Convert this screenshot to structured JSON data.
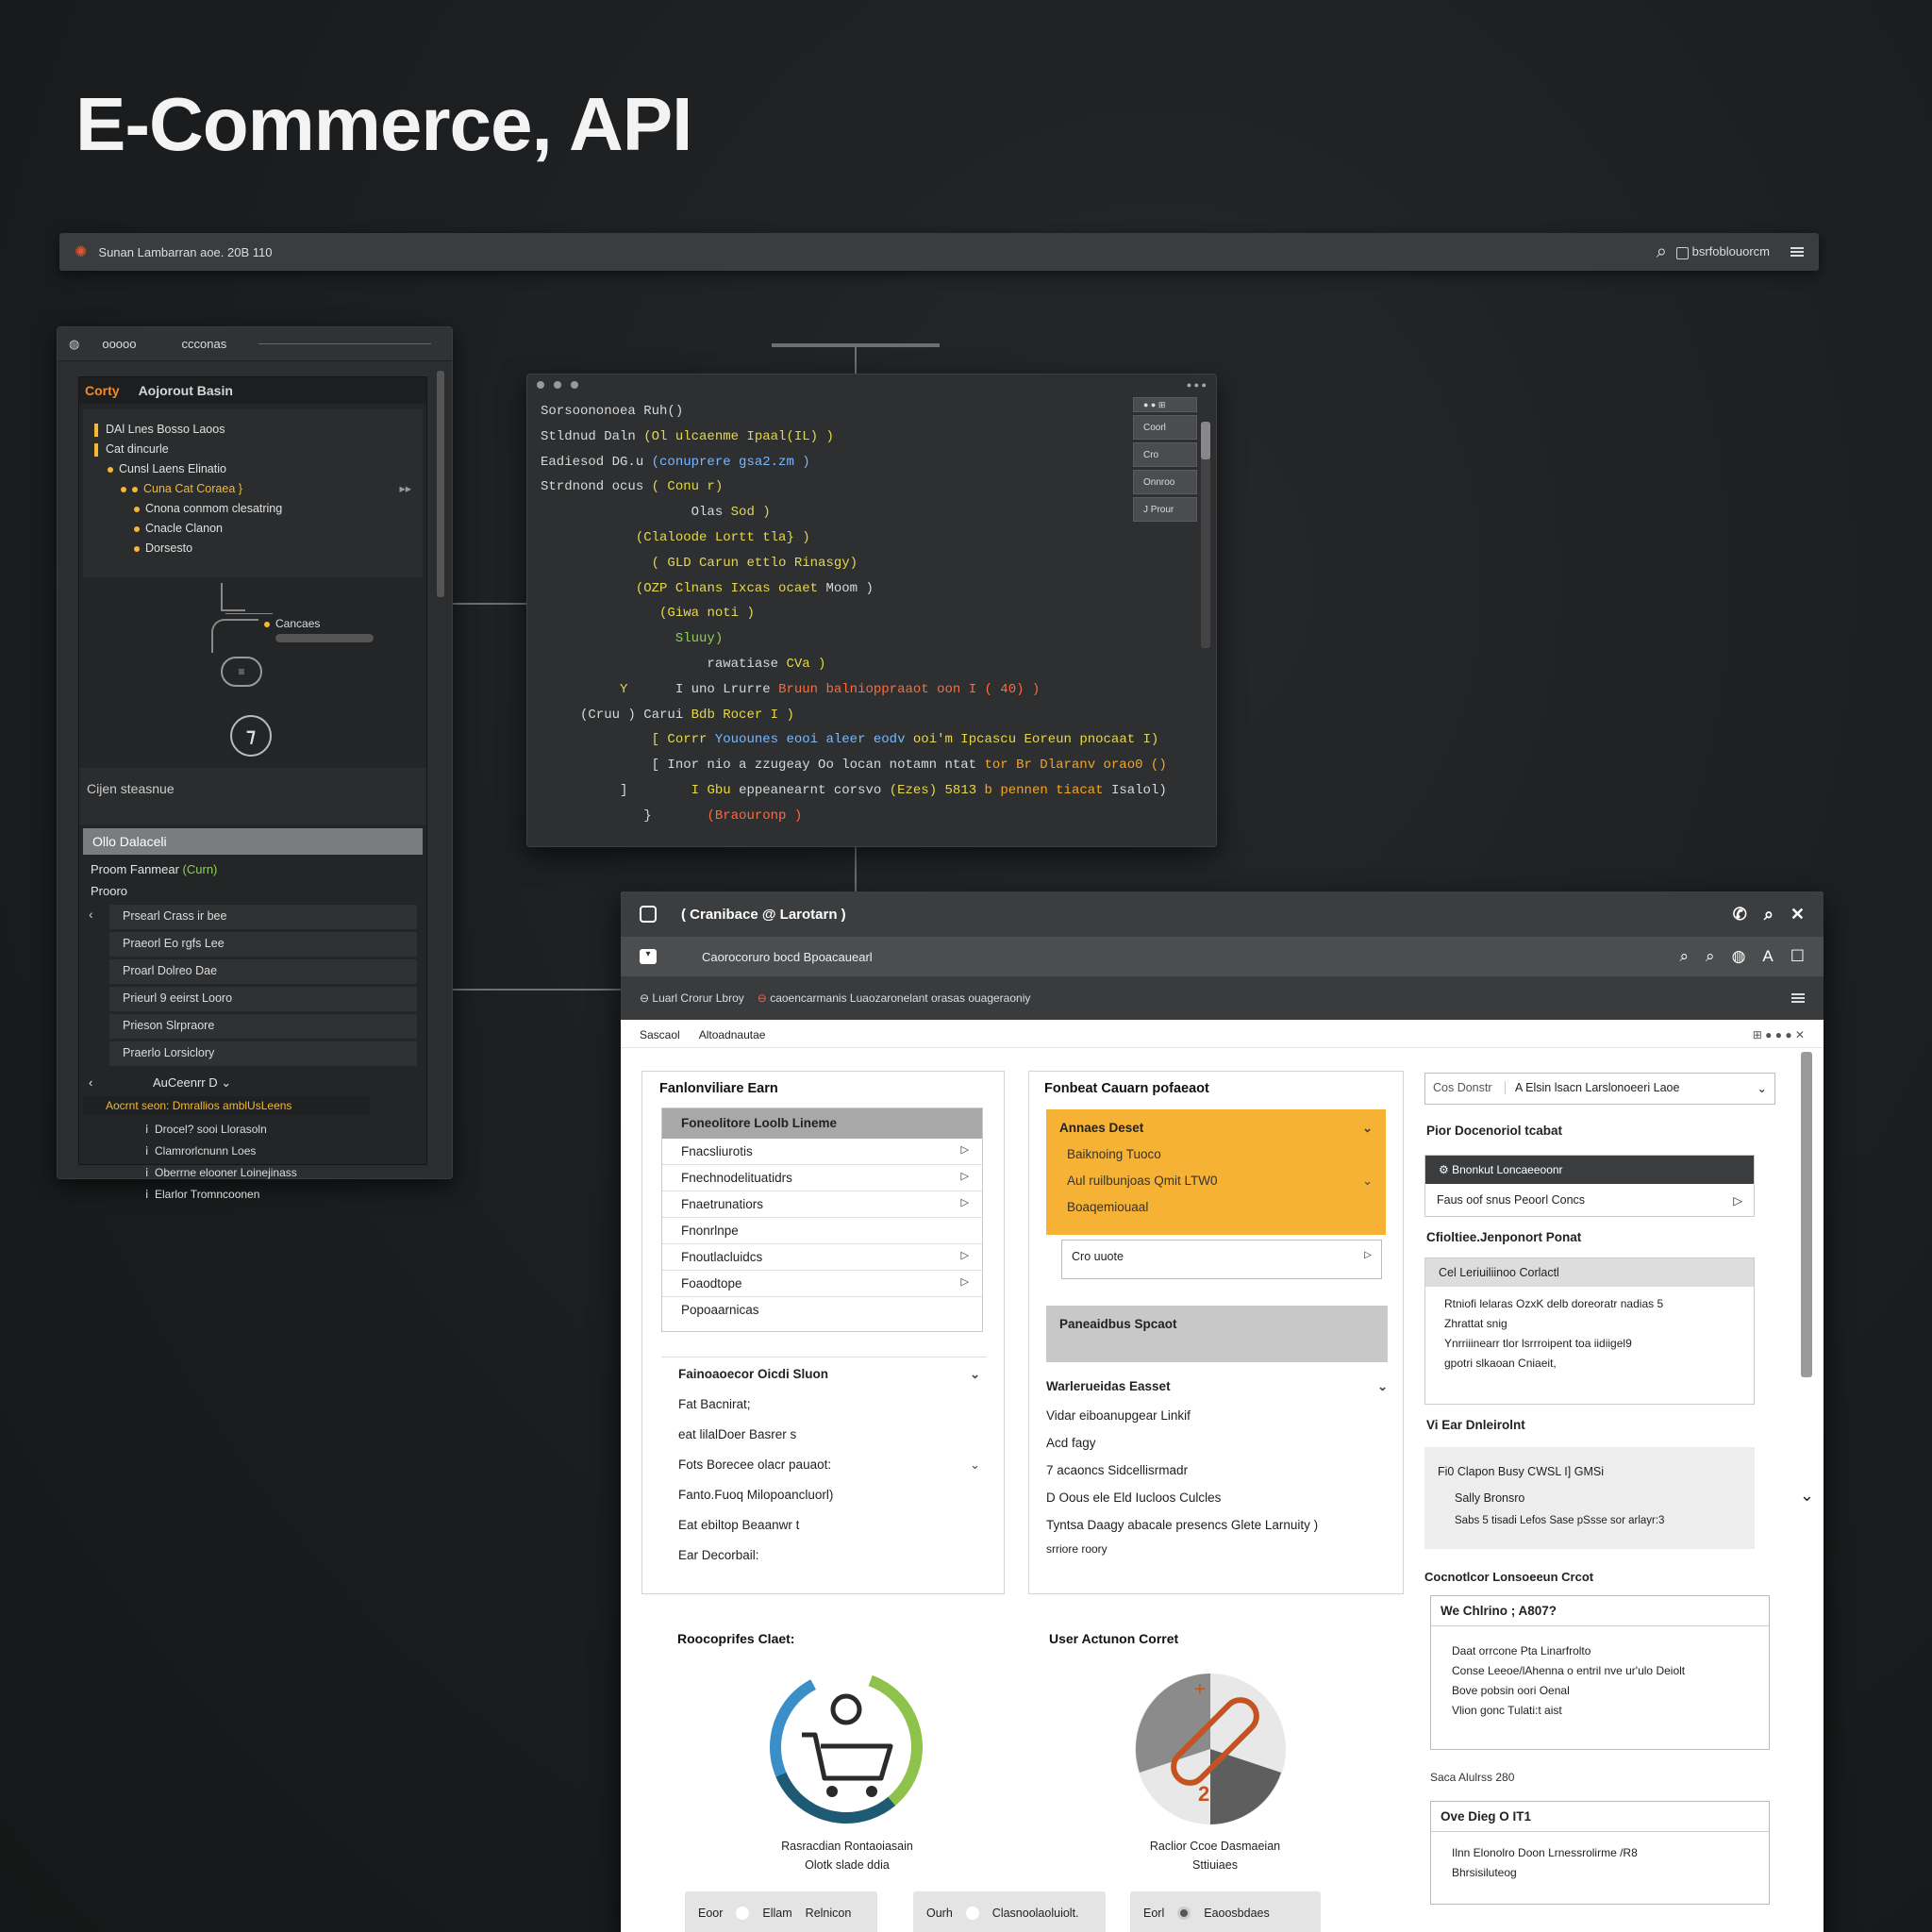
{
  "title": "E-Commerce, API",
  "topbar": {
    "brand": "Sunan Lambarran aoe. 20B 110",
    "right_label": "bsrfoblouorcm"
  },
  "left_panel": {
    "tabs": [
      "ooooo",
      "ccconas"
    ],
    "header": {
      "accent": "Corty",
      "label": "Aojorout Basin"
    },
    "tree": [
      {
        "text": "DAl Lnes Bosso Laoos",
        "style": "bar"
      },
      {
        "text": "Cat dincurle",
        "style": "bar"
      },
      {
        "text": "Cunsl Laens Elinatio",
        "style": "dot1"
      },
      {
        "text": "Cuna Cat Coraea }",
        "style": "dot2y"
      },
      {
        "text": "Cnona conmom clesatring",
        "style": "dot3"
      },
      {
        "text": "Cnacle Clanon",
        "style": "dot3"
      },
      {
        "text": "Dorsesto",
        "style": "dot3"
      }
    ],
    "node_label": "Cancaes",
    "section_title": "Cijen steasnue",
    "selected": "Ollo Dalaceli",
    "meta1": "Proom Fanmear",
    "meta1_accent": "(Curn)",
    "meta2": "Prooro",
    "rows": [
      "Prsearl Crass ir bee",
      "Praeorl Eo rgfs Lee",
      "Proarl Dolreo Dae",
      "Prieurl 9 eeirst Looro",
      "Prieson Slrpraore",
      "Praerlo Lorsiclory"
    ],
    "group_label": "AuCeenrr D",
    "group_highlight": "Aocrnt seon: Dmrallios amblUsLeens",
    "subitems": [
      "Drocel? sooi Llorasoln",
      "Clamrorlcnunn Loes",
      "Oberrne elooner Loinejinass",
      "Elarlor Tromncoonen"
    ]
  },
  "code": {
    "side_items": [
      "Coorl",
      "Cro",
      "Onnroo",
      "J Prour"
    ],
    "lines": [
      [
        {
          "t": "Sorsoononoea Ruh()",
          "c": ""
        }
      ],
      [
        {
          "t": "Stldnud Daln ",
          "c": ""
        },
        {
          "t": "(Ol ulcaenme Ipaal(IL) )",
          "c": "cy"
        }
      ],
      [
        {
          "t": "Eadiesod DG.u ",
          "c": ""
        },
        {
          "t": "(conuprere gsa2.zm )",
          "c": "cb"
        }
      ],
      [
        {
          "t": "Strdnond ocus ",
          "c": ""
        },
        {
          "t": "( Conu r)",
          "c": "cy"
        }
      ],
      [
        {
          "t": "                   Olas ",
          "c": ""
        },
        {
          "t": "Sod )",
          "c": "cy"
        }
      ],
      [
        {
          "t": "            ",
          "c": ""
        },
        {
          "t": "(Claloode Lortt tla} )",
          "c": "cy"
        }
      ],
      [
        {
          "t": "              ",
          "c": ""
        },
        {
          "t": "( GLD Carun ettlo Rinasgy)",
          "c": "cy"
        }
      ],
      [
        {
          "t": "            ",
          "c": ""
        },
        {
          "t": "(OZP Clnans Ixcas ocaet ",
          "c": "cy"
        },
        {
          "t": "Moom )",
          "c": ""
        }
      ],
      [
        {
          "t": "               ",
          "c": ""
        },
        {
          "t": "(Giwa noti )",
          "c": "cy"
        }
      ],
      [
        {
          "t": "                 ",
          "c": ""
        },
        {
          "t": "Sluuy)",
          "c": "cg"
        }
      ],
      [
        {
          "t": "                     rawatiase ",
          "c": ""
        },
        {
          "t": "CVa )",
          "c": "cy"
        }
      ],
      [
        {
          "t": "          ",
          "c": ""
        },
        {
          "t": "Y",
          "c": "cy"
        },
        {
          "t": "      I uno Lrurre ",
          "c": ""
        },
        {
          "t": "Bruun balnioppraaot oon I ( 40) )",
          "c": "cr"
        }
      ],
      [
        {
          "t": "     (Cruu ) Carui ",
          "c": ""
        },
        {
          "t": "Bdb Rocer I )",
          "c": "cy"
        }
      ],
      [
        {
          "t": "              ",
          "c": ""
        },
        {
          "t": "[ Corrr ",
          "c": "cy"
        },
        {
          "t": "Youounes eooi aleer eodv ",
          "c": "cb"
        },
        {
          "t": "ooi'm Ipcascu Eoreun pnocaat I)",
          "c": "cy"
        }
      ],
      [
        {
          "t": "              ",
          "c": ""
        },
        {
          "t": "[ Inor nio a zzugeay Oo locan notamn ntat ",
          "c": ""
        },
        {
          "t": "tor Br Dlaranv orao0 ()",
          "c": "co"
        }
      ],
      [
        {
          "t": "          ]        ",
          "c": ""
        },
        {
          "t": "I Gbu ",
          "c": "cy"
        },
        {
          "t": "eppeanearnt corsvo ",
          "c": ""
        },
        {
          "t": "(Ezes) 5813 ",
          "c": "cy"
        },
        {
          "t": "b pennen tiacat ",
          "c": "co"
        },
        {
          "t": "Isalol)",
          "c": ""
        }
      ],
      [
        {
          "t": "             }       ",
          "c": ""
        },
        {
          "t": "(Braouronp )",
          "c": "cr"
        }
      ]
    ]
  },
  "app": {
    "title": "( Cranibace @ Larotarn )",
    "subtitle": "Caorocoruro bocd Bpoacauearl",
    "toolbar_left": "Luarl Crorur Lbroy",
    "toolbar_mid": "caoencarmanis Luaozaronelant orasas ouageraoniy",
    "breadcrumb": [
      "Sascaol",
      "Altoadnautae"
    ],
    "card1": {
      "title": "Fanlonviliare Earn",
      "list_header": "Foneolitore Loolb Lineme",
      "items": [
        "Fnacsliurotis",
        "Fnechnodelituatidrs",
        "Fnaetrunatiors",
        "Fnonrlnpe",
        "Fnoutlacluidcs",
        "Foaodtope",
        "Popoaarnicas"
      ],
      "group_title": "Fainoaoecor Oicdi Sluon",
      "group_items": [
        "Fat Bacnirat;",
        "eat lilalDoer Basrer s",
        "Fots Borecee olacr pauaot:",
        "Fanto.Fuoq Milopoancluorl)",
        "Eat ebiltop Beaanwr t",
        "Ear Decorbail:"
      ]
    },
    "card2": {
      "title": "Fonbeat Cauarn pofaeaot",
      "yellow_title": "Annaes Deset",
      "yellow_lines": [
        "Baiknoing Tuoco",
        "Aul ruilbunjoas Qmit LTW0",
        "Boaqemiouaal"
      ],
      "input_label": "Cro uuote",
      "gray_title": "Paneaidbus Spcaot",
      "sub_title": "Warlerueidas Easset",
      "lines": [
        "Vidar eiboanupgear Linkif",
        "Acd fagy",
        "7 acaoncs Sidcellisrmadr",
        "D Oous ele Eld Iucloos Culcles",
        "Tyntsa Daagy abacale presencs Glete Larnuity )",
        "srriore roory"
      ]
    },
    "card3": {
      "select_left": "Cos Donstr",
      "select_right": "Elsin lsacn Larslonoeeri Laoe",
      "title1": "Pior Docenoriol tcabat",
      "dark_item": "Bnonkut Loncaeeoonr",
      "list_item": "Faus oof snus Peoorl Concs",
      "title2": "Cfioltiee.Jenponort Ponat",
      "box_header": "Cel Leriuiliinoo Corlactl",
      "box_lines": [
        "Rtniofi lelaras OzxK delb doreoratr nadias 5",
        "Zhrattat snig",
        "Ynrriiinearr tlor lsrrroipent toa iidiigel9",
        "gpotri slkaoan Cniaeit,"
      ],
      "title3": "Vi Ear Dnleirolnt",
      "box2_lines": [
        "Fi0 Clapon Busy CWSL I] GMSi",
        "Sally Bronsro",
        "Sabs 5 tisadi Lefos Sase pSsse sor arlayr:3"
      ],
      "title4": "Cocnotlcor Lonsoeeun Crcot",
      "box3_title": "We Chlrino ; A807?",
      "box3_lines": [
        "Daat orrcone Pta Linarfrolto",
        "Conse Leeoe/lAhenna o entril nve ur'ulo Deiolt",
        "Bove pobsin oori Oenal",
        "Vlion gonc Tulati:t aist"
      ],
      "note": "Saca Alulrss 280",
      "box4_title": "Ove Dieg O IT1",
      "box4_lines": [
        "Ilnn Elonolro Doon Lrnessrolirme /R8",
        "Bhrsisiluteog"
      ]
    },
    "chart1": {
      "title": "Roocoprifes Claet:",
      "caption1": "Rasracdian Rontaoiasain",
      "caption2": "Olotk slade ddia"
    },
    "chart2": {
      "title": "User Actunon Corret",
      "number": "2",
      "caption1": "Raclior Ccoe Dasmaeian",
      "caption2": "Sttiuiaes"
    },
    "pills": [
      [
        "Eoor",
        "Ellam",
        "Relnicon"
      ],
      [
        "Ourh",
        "Clasnoolaoluiolt."
      ],
      [
        "Eorl",
        "Eaoosbdaes"
      ]
    ]
  },
  "colors": {
    "accent_yellow": "#f6b234",
    "accent_orange": "#f08a2c",
    "code_yellow": "#e6d84a",
    "code_green": "#8fd14f",
    "code_red": "#ff6a3c"
  }
}
